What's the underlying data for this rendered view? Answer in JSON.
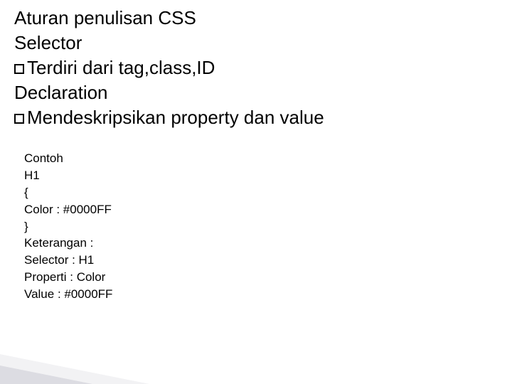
{
  "title": "Aturan penulisan CSS",
  "section1": {
    "heading": "Selector",
    "bullet": "Terdiri dari tag,class,ID"
  },
  "section2": {
    "heading": "Declaration",
    "bullet": "Mendeskripsikan property dan value"
  },
  "example": {
    "l1": "Contoh",
    "l2": "H1",
    "l3": "{",
    "l4": "Color : #0000FF",
    "l5": "}",
    "l6": "Keterangan :",
    "l7": "Selector : H1",
    "l8": "Properti : Color",
    "l9": "Value : #0000FF"
  }
}
